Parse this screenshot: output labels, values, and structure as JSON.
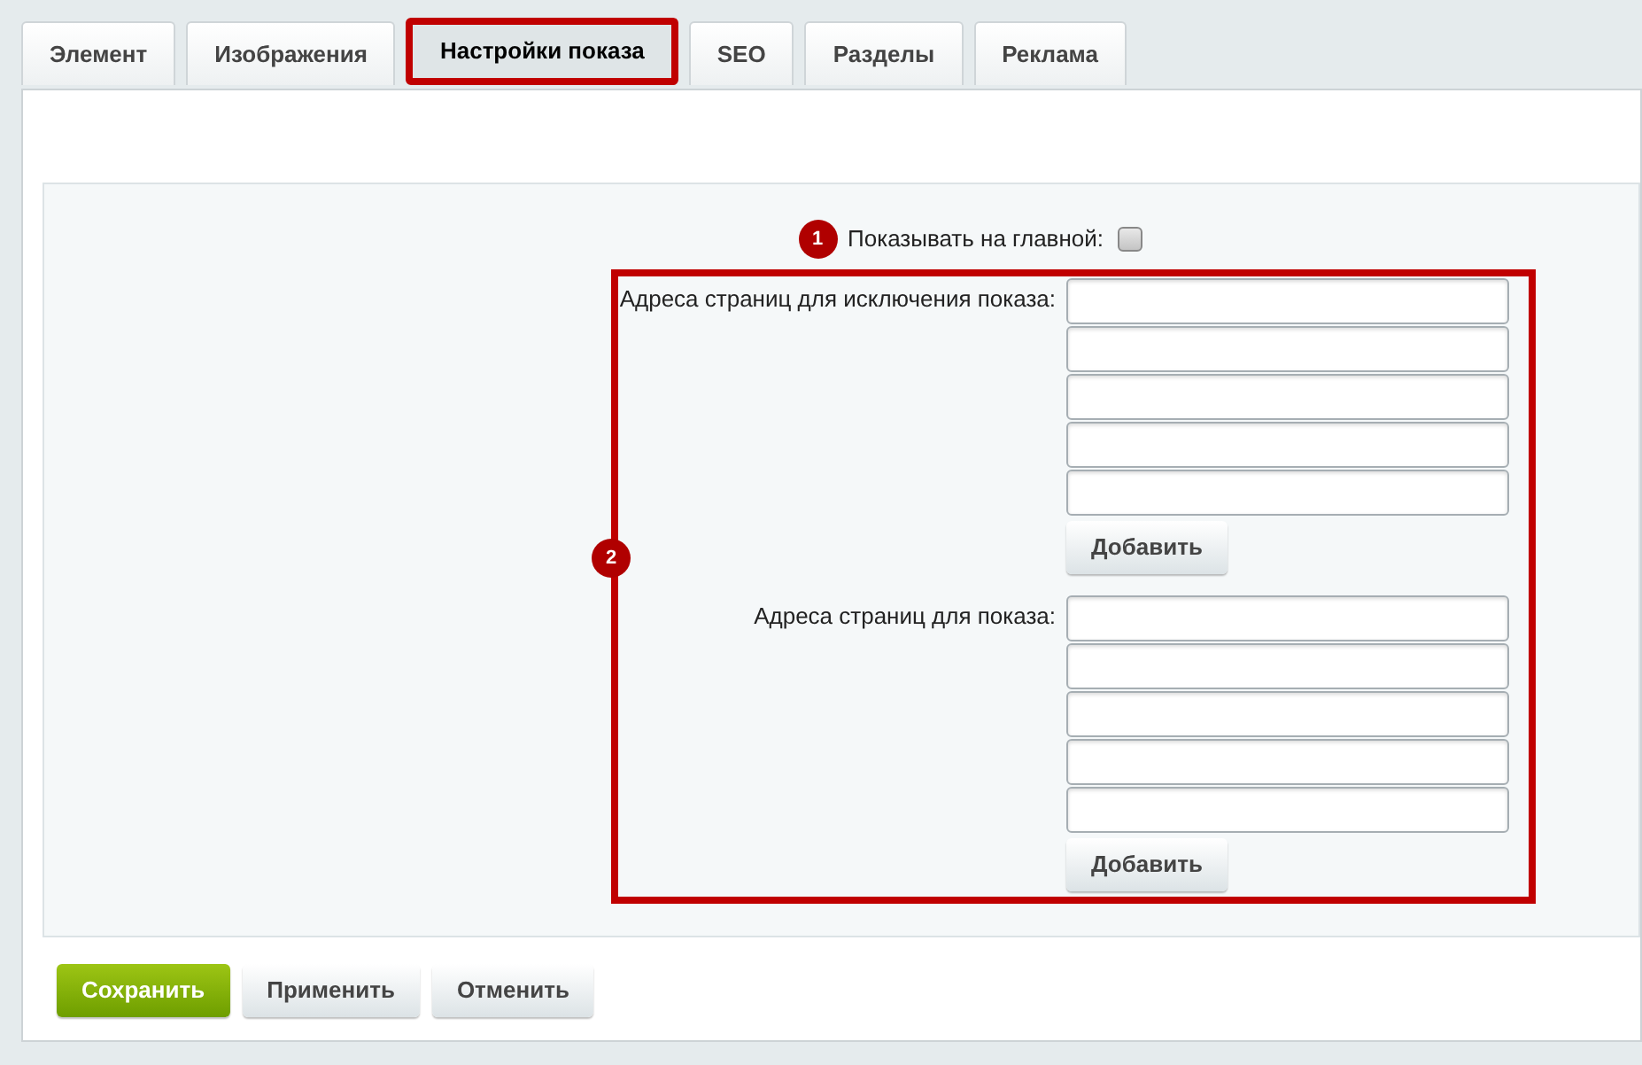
{
  "tabs": [
    {
      "label": "Элемент",
      "selected": false,
      "annotated": false
    },
    {
      "label": "Изображения",
      "selected": false,
      "annotated": false
    },
    {
      "label": "Настройки показа",
      "selected": true,
      "annotated": true
    },
    {
      "label": "SEO",
      "selected": false,
      "annotated": false
    },
    {
      "label": "Разделы",
      "selected": false,
      "annotated": false
    },
    {
      "label": "Реклама",
      "selected": false,
      "annotated": false
    }
  ],
  "show_on_main": {
    "marker": "1",
    "label": "Показывать на главной:",
    "checked": false
  },
  "annotation": {
    "marker": "2"
  },
  "sections": [
    {
      "label": "Адреса страниц для исключения показа:",
      "fields": [
        {
          "kind": "text"
        },
        {
          "kind": "text"
        },
        {
          "kind": "text"
        },
        {
          "kind": "text"
        },
        {
          "kind": "text"
        }
      ],
      "add_button": "Добавить"
    },
    {
      "label": "Адреса страниц для показа:",
      "fields": [
        {
          "kind": "text"
        },
        {
          "kind": "text"
        },
        {
          "kind": "text"
        },
        {
          "kind": "text"
        },
        {
          "kind": "text"
        }
      ],
      "add_button": "Добавить"
    }
  ],
  "buttons": [
    {
      "label": "Сохранить",
      "kind": "primary"
    },
    {
      "label": "Применить",
      "kind": "default"
    },
    {
      "label": "Отменить",
      "kind": "default"
    }
  ]
}
